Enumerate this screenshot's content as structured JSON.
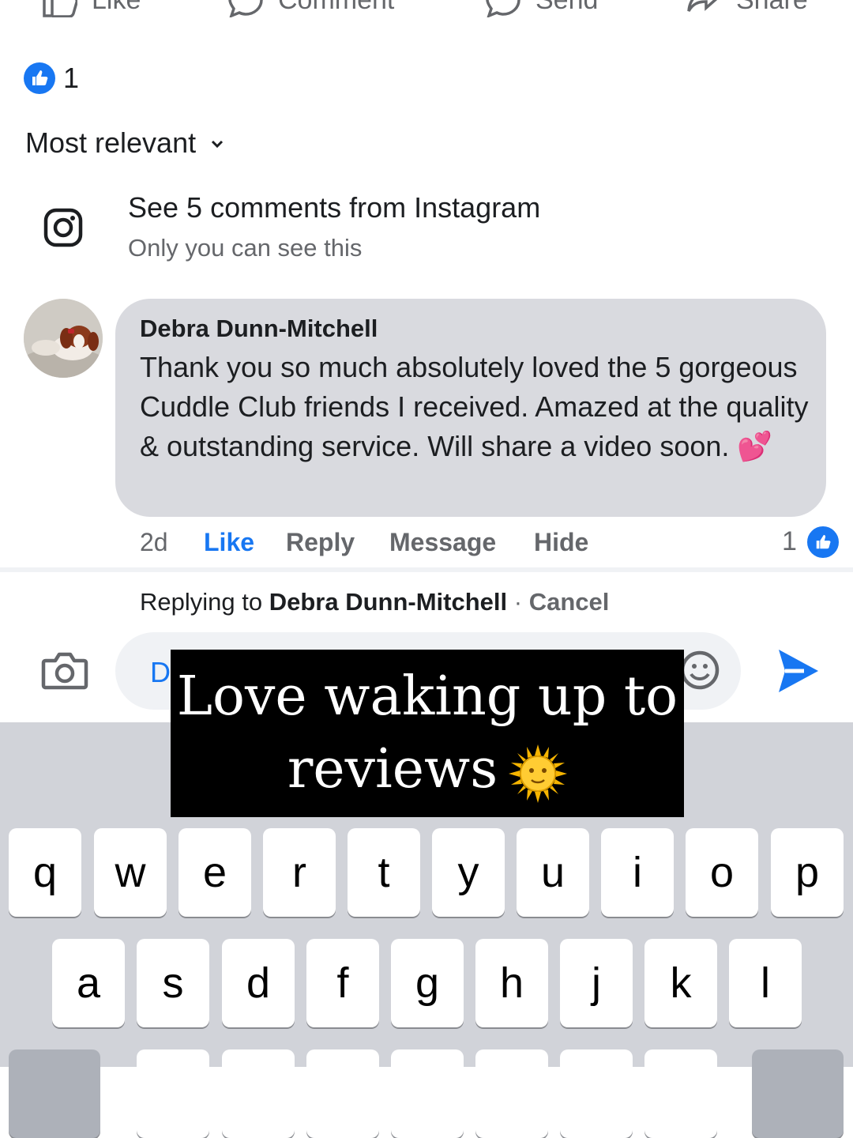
{
  "top_actions": [
    "Like",
    "Comment",
    "Send",
    "Share"
  ],
  "reactions": {
    "count": "1",
    "icon": "thumbs-up-icon"
  },
  "sort": {
    "label": "Most relevant"
  },
  "instagram": {
    "title": "See 5 comments from Instagram",
    "subtitle": "Only you can see this"
  },
  "comment": {
    "author": "Debra Dunn-Mitchell",
    "text": "Thank you so much absolutely loved the 5 gorgeous Cuddle Club friends I received. Amazed at the quality & outstanding service. Will share a video soon.",
    "emoji": "💕",
    "time": "2d",
    "actions": {
      "like": "Like",
      "reply": "Reply",
      "message": "Message",
      "hide": "Hide"
    },
    "reaction_count": "1"
  },
  "reply_bar": {
    "prefix": "Replying to",
    "name": "Debra Dunn-Mitchell",
    "separator": "·",
    "cancel": "Cancel"
  },
  "composer": {
    "text": "D"
  },
  "overlay": {
    "line1": "Love waking up to",
    "line2": "reviews",
    "emoji": "🌞"
  },
  "keyboard": {
    "row1": [
      "q",
      "w",
      "e",
      "r",
      "t",
      "y",
      "u",
      "i",
      "o",
      "p"
    ],
    "row2": [
      "a",
      "s",
      "d",
      "f",
      "g",
      "h",
      "j",
      "k",
      "l"
    ]
  },
  "colors": {
    "accent": "#1877f2",
    "bubble": "#d9dadf",
    "keyboard": "#d1d3d9"
  }
}
